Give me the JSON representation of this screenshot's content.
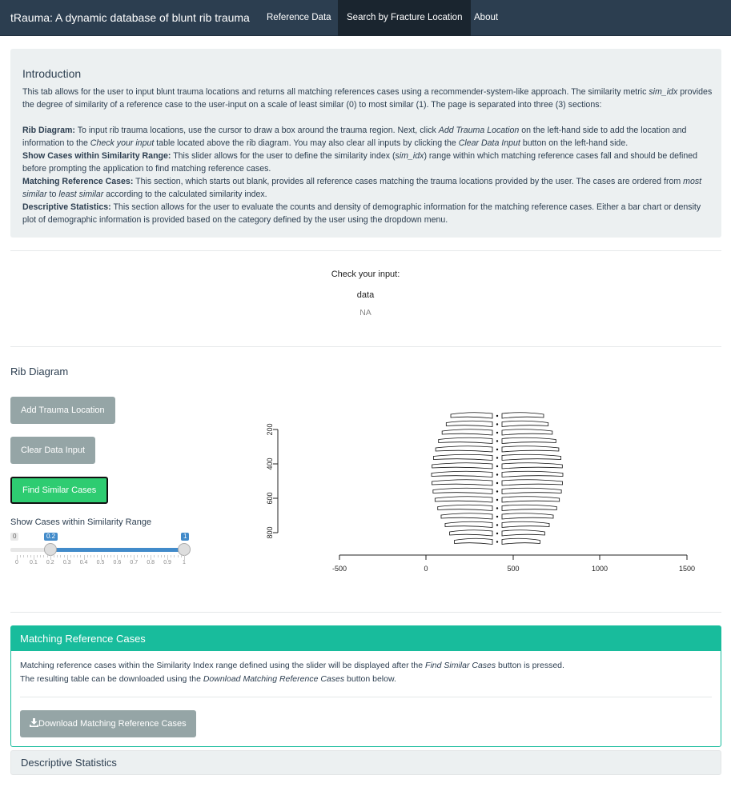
{
  "navbar": {
    "brand": "tRauma: A dynamic database of blunt rib trauma",
    "tabs": [
      {
        "label": "Reference Data"
      },
      {
        "label": "Search by Fracture Location"
      },
      {
        "label": "About"
      }
    ]
  },
  "intro": {
    "title": "Introduction",
    "p1_a": "This tab allows for the user to input blunt trauma locations and returns all matching references cases using a recommender-system-like approach. The similarity metric ",
    "p1_em": "sim_idx",
    "p1_b": " provides the degree of similarity of a reference case to the user-input on a scale of least similar (0) to most similar (1). The page is separated into three (3) sections:",
    "rib_label": "Rib Diagram:",
    "rib_a": " To input rib trauma locations, use the cursor to draw a box around the trauma region. Next, click ",
    "rib_em1": "Add Trauma Location",
    "rib_b": " on the left-hand side to add the location and information to the ",
    "rib_em2": "Check your input",
    "rib_c": " table located above the rib diagram. You may also clear all inputs by clicking the ",
    "rib_em3": "Clear Data Input",
    "rib_d": " button on the left-hand side.",
    "range_label": "Show Cases within Similarity Range:",
    "range_a": " This slider allows for the user to define the similarity index (",
    "range_em": "sim_idx",
    "range_b": ") range within which matching reference cases fall and should be defined before prompting the application to find matching reference cases.",
    "match_label": "Matching Reference Cases:",
    "match_a": " This section, which starts out blank, provides all reference cases matching the trauma locations provided by the user. The cases are ordered from ",
    "match_em1": "most similar",
    "match_b": " to ",
    "match_em2": "least similar",
    "match_c": " according to the calculated similarity index.",
    "desc_label": "Descriptive Statistics:",
    "desc_a": " This section allows for the user to evaluate the counts and density of demographic information for the matching reference cases. Either a bar chart or density plot of demographic information is provided based on the category defined by the user using the dropdown menu."
  },
  "check": {
    "title": "Check your input:",
    "column": "data",
    "value": "NA"
  },
  "rib_section": {
    "title": "Rib Diagram",
    "add_button": "Add Trauma Location",
    "clear_button": "Clear Data Input",
    "find_button": "Find Similar Cases",
    "slider": {
      "label": "Show Cases within Similarity Range",
      "min": "0",
      "max": "1",
      "from": 0.2,
      "to": 1,
      "from_label": "0.2",
      "to_label": "1",
      "grid_labels": [
        "0",
        "0.1",
        "0.2",
        "0.3",
        "0.4",
        "0.5",
        "0.6",
        "0.7",
        "0.8",
        "0.9",
        "1"
      ]
    },
    "plot": {
      "x_ticks": [
        "-500",
        "0",
        "500",
        "1000",
        "1500"
      ],
      "y_ticks": [
        "200",
        "400",
        "600",
        "800"
      ]
    }
  },
  "matching": {
    "title": "Matching Reference Cases",
    "line1_a": "Matching reference cases within the Similarity Index range defined using the slider will be displayed after the ",
    "line1_em": "Find Similar Cases",
    "line1_b": " button is pressed.",
    "line2_a": "The resulting table can be downloaded using the ",
    "line2_em": "Download Matching Reference Cases",
    "line2_b": " button below.",
    "download_button": "Download Matching Reference Cases",
    "download_icon": "download-icon"
  },
  "descriptive": {
    "title": "Descriptive Statistics"
  },
  "colors": {
    "navbar": "#2c3e50",
    "accent": "#18bc9c",
    "green_button": "#2ecc71",
    "grey_button": "#95a5a6",
    "slider": "#428bca"
  }
}
